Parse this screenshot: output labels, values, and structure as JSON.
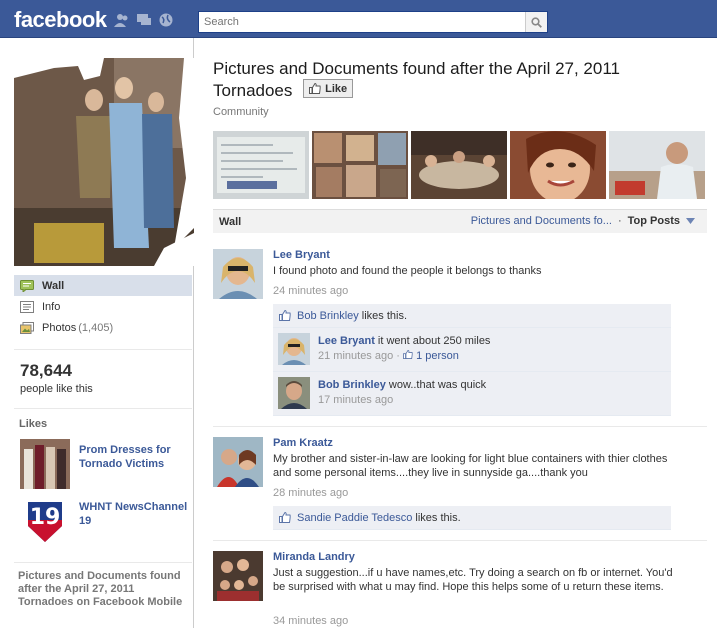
{
  "topbar": {
    "logo": "facebook",
    "search_placeholder": "Search",
    "accent": "#3b5998"
  },
  "sidebar": {
    "nav": [
      {
        "label": "Wall",
        "icon": "wall-icon",
        "count": ""
      },
      {
        "label": "Info",
        "icon": "info-icon",
        "count": ""
      },
      {
        "label": "Photos",
        "icon": "photos-icon",
        "count": "(1,405)"
      }
    ],
    "likes_count": "78,644",
    "likes_text": "people like this",
    "likes_heading": "Likes",
    "liked_pages": [
      {
        "name": "Prom Dresses for Tornado Victims"
      },
      {
        "name": "WHNT NewsChannel 19"
      }
    ],
    "mobile_text": "Pictures and Documents found after the April 27, 2011 Tornadoes on Facebook Mobile"
  },
  "page": {
    "title": "Pictures and Documents found after the April 27, 2011 Tornadoes",
    "like_button": "Like",
    "category": "Community"
  },
  "wall": {
    "label": "Wall",
    "filter_name": "Pictures and Documents fo...",
    "filter_sep": "·",
    "top_posts": "Top Posts"
  },
  "posts": [
    {
      "author": "Lee Bryant",
      "message": "I found photo and found the people it belongs to thanks",
      "time": "24 minutes ago",
      "likes": {
        "names": "Bob Brinkley",
        "suffix": "likes this."
      },
      "comments": [
        {
          "author": "Lee Bryant",
          "text": "it went about 250 miles",
          "time": "21 minutes ago",
          "sep": "·",
          "like_count": "1 person"
        },
        {
          "author": "Bob Brinkley",
          "text": "wow..that was quick",
          "time": "17 minutes ago"
        }
      ]
    },
    {
      "author": "Pam Kraatz",
      "message": "My brother and sister-in-law are looking for light blue containers with thier clothes and some personal items....they live in sunnyside ga....thank you",
      "time": "28 minutes ago",
      "likes": {
        "names": "Sandie Paddie Tedesco",
        "suffix": "likes this."
      }
    },
    {
      "author": "Miranda Landry",
      "message": "Just a suggestion...if u have names,etc. Try doing a search on fb or internet. You'd be surprised with what u may find. Hope this helps some of u return these items.",
      "time": "34 minutes ago"
    }
  ]
}
